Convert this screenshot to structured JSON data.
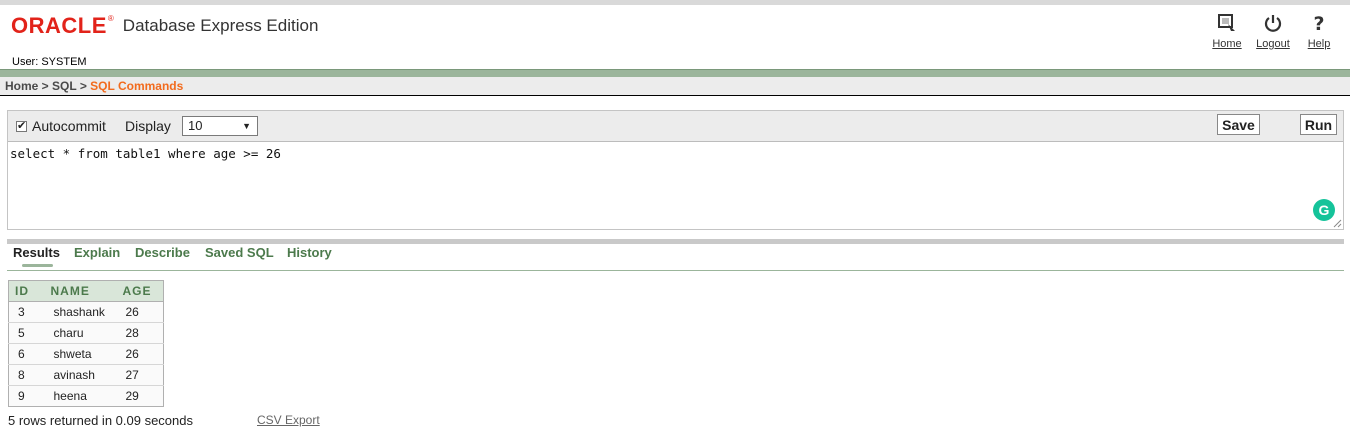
{
  "header": {
    "logo_text": "ORACLE",
    "logo_reg": "®",
    "product": "Database Express Edition",
    "user_label": "User: SYSTEM",
    "links": [
      {
        "label": "Home",
        "icon": "home-icon"
      },
      {
        "label": "Logout",
        "icon": "power-icon"
      },
      {
        "label": "Help",
        "icon": "question-icon"
      }
    ]
  },
  "breadcrumb": {
    "home": "Home",
    "sep1": " > ",
    "sql": "SQL",
    "sep2": " > ",
    "current": "SQL Commands"
  },
  "toolbar": {
    "autocommit_label": "Autocommit",
    "autocommit_checked": true,
    "display_label": "Display",
    "display_value": "10",
    "save_label": "Save",
    "run_label": "Run"
  },
  "editor": {
    "sql": "select * from table1 where age >= 26",
    "grammarly_letter": "G"
  },
  "tabs": [
    "Results",
    "Explain",
    "Describe",
    "Saved SQL",
    "History"
  ],
  "active_tab": "Results",
  "results": {
    "columns": [
      "ID",
      "NAME",
      "AGE"
    ],
    "rows": [
      [
        "3",
        "shashank",
        "26"
      ],
      [
        "5",
        "charu",
        "28"
      ],
      [
        "6",
        "shweta",
        "26"
      ],
      [
        "8",
        "avinash",
        "27"
      ],
      [
        "9",
        "heena",
        "29"
      ]
    ],
    "status": "5 rows returned in 0.09 seconds",
    "csv_export": "CSV Export"
  },
  "colors": {
    "oracle_red": "#e2231a",
    "green_bar": "#9bb59b",
    "tab_green": "#4c7a4c",
    "breadcrumb_orange": "#f26b1d",
    "grammarly": "#15c39a"
  }
}
